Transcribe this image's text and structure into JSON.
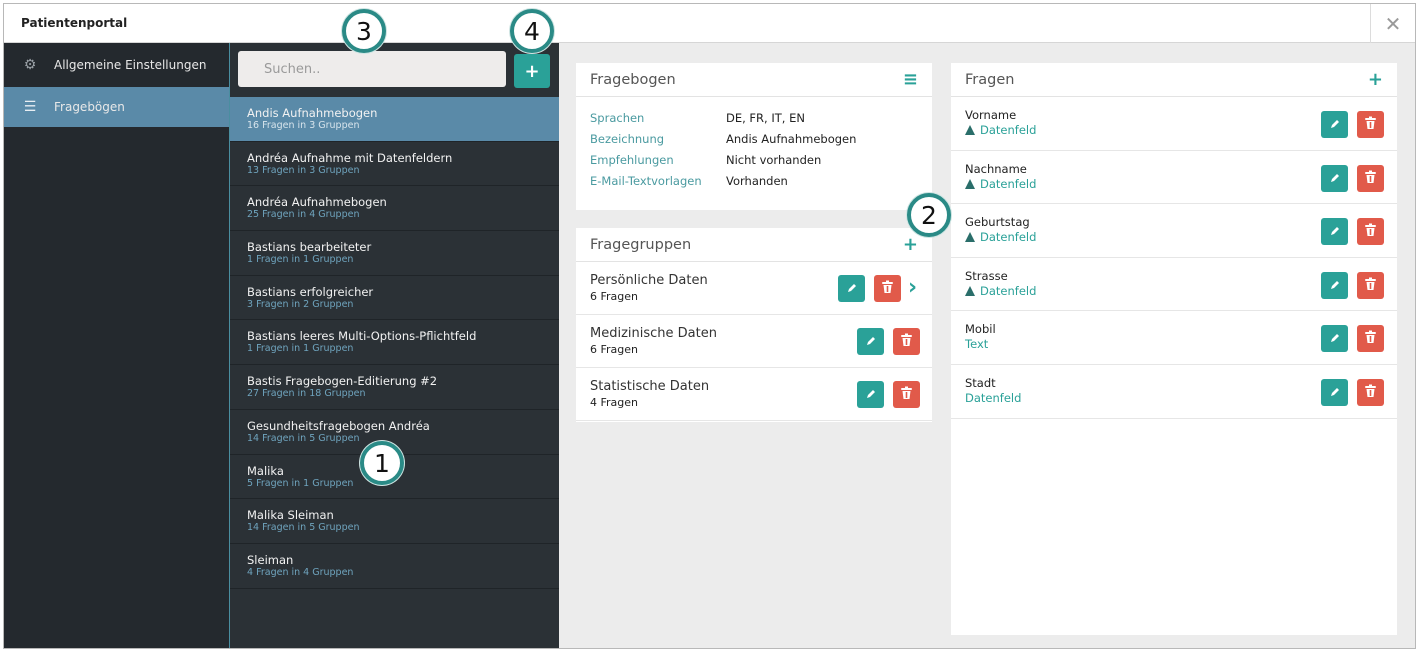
{
  "window": {
    "title": "Patientenportal"
  },
  "nav": {
    "items": [
      {
        "label": "Allgemeine Einstellungen",
        "icon": "gear-icon"
      },
      {
        "label": "Fragebögen",
        "icon": "list-icon",
        "active": true
      }
    ]
  },
  "search": {
    "placeholder": "Suchen.."
  },
  "questionnaires": [
    {
      "name": "Andis Aufnahmebogen",
      "sub": "16 Fragen in 3 Gruppen",
      "active": true
    },
    {
      "name": "Andréa Aufnahme mit Datenfeldern",
      "sub": "13 Fragen in 3 Gruppen"
    },
    {
      "name": "Andréa Aufnahmebogen",
      "sub": "25 Fragen in 4 Gruppen"
    },
    {
      "name": "Bastians bearbeiteter",
      "sub": "1 Fragen in 1 Gruppen"
    },
    {
      "name": "Bastians erfolgreicher",
      "sub": "3 Fragen in 2 Gruppen"
    },
    {
      "name": "Bastians leeres Multi-Options-Pflichtfeld",
      "sub": "1 Fragen in 1 Gruppen"
    },
    {
      "name": "Bastis Fragebogen-Editierung #2",
      "sub": "27 Fragen in 18 Gruppen"
    },
    {
      "name": "Gesundheitsfragebogen Andréa",
      "sub": "14 Fragen in 5 Gruppen"
    },
    {
      "name": "Malika",
      "sub": "5 Fragen in 1 Gruppen"
    },
    {
      "name": "Malika Sleiman",
      "sub": "14 Fragen in 5 Gruppen"
    },
    {
      "name": "Sleiman",
      "sub": "4 Fragen in 4 Gruppen"
    }
  ],
  "fragebogen": {
    "title": "Fragebogen",
    "rows": [
      {
        "key": "Sprachen",
        "value": "DE, FR, IT, EN"
      },
      {
        "key": "Bezeichnung",
        "value": "Andis Aufnahmebogen"
      },
      {
        "key": "Empfehlungen",
        "value": "Nicht vorhanden"
      },
      {
        "key": "E-Mail-Textvorlagen",
        "value": "Vorhanden"
      }
    ]
  },
  "fragegruppen": {
    "title": "Fragegruppen",
    "items": [
      {
        "name": "Persönliche Daten",
        "sub": "6 Fragen",
        "expandable": true
      },
      {
        "name": "Medizinische Daten",
        "sub": "6 Fragen"
      },
      {
        "name": "Statistische Daten",
        "sub": "4 Fragen"
      }
    ]
  },
  "fragen": {
    "title": "Fragen",
    "items": [
      {
        "name": "Vorname",
        "type": "Datenfeld",
        "warning": true
      },
      {
        "name": "Nachname",
        "type": "Datenfeld",
        "warning": true
      },
      {
        "name": "Geburtstag",
        "type": "Datenfeld",
        "warning": true
      },
      {
        "name": "Strasse",
        "type": "Datenfeld",
        "warning": true
      },
      {
        "name": "Mobil",
        "type": "Text",
        "warning": false
      },
      {
        "name": "Stadt",
        "type": "Datenfeld",
        "warning": false
      }
    ]
  },
  "markers": [
    "1",
    "2",
    "3",
    "4"
  ],
  "colors": {
    "accent": "#2aa198",
    "delete": "#e15a4a",
    "active": "#5a8aa8",
    "sidebar": "#24292e"
  }
}
